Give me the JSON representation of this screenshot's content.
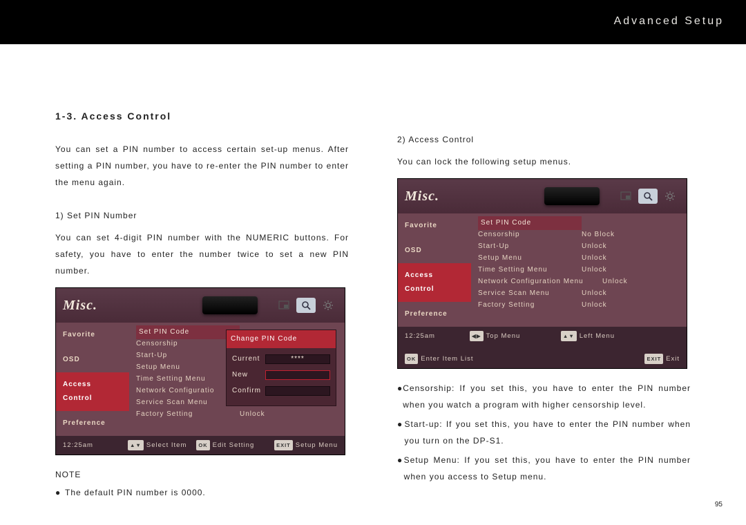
{
  "header": {
    "title": "Advanced Setup"
  },
  "section": {
    "title": "1-3. Access Control"
  },
  "left": {
    "intro": "You can set a PIN number to access certain set-up menus. After setting a PIN number, you have to re-enter the PIN number to enter the menu again.",
    "sub1_head": "1) Set PIN Number",
    "sub1_body": "You can set 4-digit PIN number with the NUMERIC buttons. For safety, you have to enter the number twice to set a new PIN number.",
    "note_label": "NOTE",
    "note_bullet": "The default PIN number is 0000."
  },
  "right": {
    "sub2_head": "2) Access Control",
    "sub2_body": "You can lock the following setup menus.",
    "bullets": [
      "Censorship: If you set this, you have to enter the PIN number when you watch a program with higher censorship level.",
      "Start-up: If you set this, you have to enter the PIN number when you turn on the DP-S1.",
      "Setup Menu: If you set this, you have to enter the PIN number when you access to Setup menu."
    ]
  },
  "osd": {
    "title": "Misc.",
    "side_items": [
      "Favorite",
      "OSD",
      "Access Control",
      "Preference"
    ],
    "side_active_index": 2,
    "menu_items": [
      {
        "k": "Set PIN Code",
        "v": ""
      },
      {
        "k": "Censorship",
        "v": "No Block"
      },
      {
        "k": "Start-Up",
        "v": "Unlock"
      },
      {
        "k": "Setup Menu",
        "v": "Unlock"
      },
      {
        "k": "Time Setting Menu",
        "v": "Unlock"
      },
      {
        "k": "Network Configuration Menu",
        "v": "Unlock"
      },
      {
        "k": "Service Scan Menu",
        "v": "Unlock"
      },
      {
        "k": "Factory Setting",
        "v": "Unlock"
      }
    ],
    "pin_dialog": {
      "title": "Change PIN Code",
      "rows": [
        {
          "label": "Current",
          "value": "****"
        },
        {
          "label": "New",
          "value": ""
        },
        {
          "label": "Confirm",
          "value": ""
        }
      ]
    },
    "time": "12:25am",
    "foot1": {
      "key1": "▲▼",
      "t1": "Select Item",
      "key2": "OK",
      "t2": "Edit Setting",
      "key3": "EXIT",
      "t3": "Setup Menu"
    },
    "foot2": {
      "key1": "◀▶",
      "t1": "Top Menu",
      "key2": "▲▼",
      "t2": "Left Menu",
      "key3": "OK",
      "t3": "Enter Item List",
      "key4": "EXIT",
      "t4": "Exit"
    }
  },
  "page_number": "95"
}
